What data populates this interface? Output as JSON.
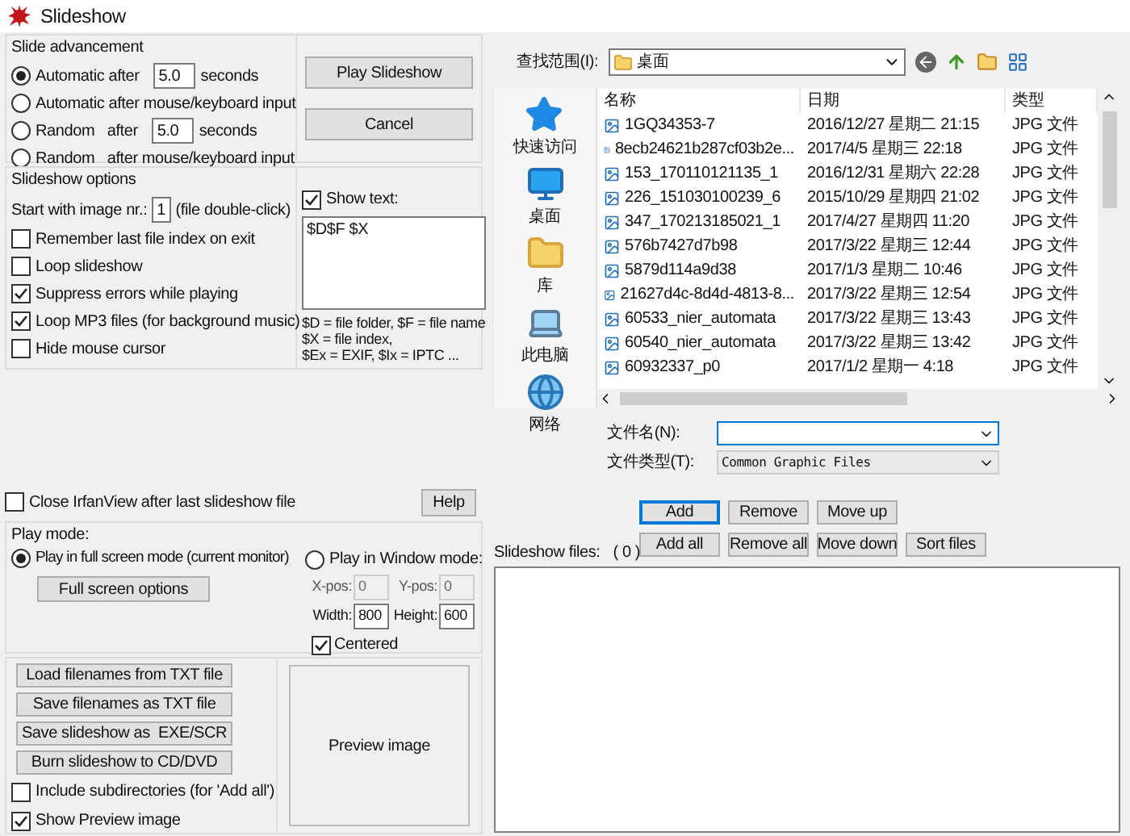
{
  "window": {
    "title": "Slideshow"
  },
  "slide_advancement": {
    "title": "Slide advancement",
    "options": [
      {
        "kind": "timed",
        "label": "Automatic after",
        "value": "5.0",
        "unit": "seconds",
        "selected": true
      },
      {
        "kind": "plain",
        "label": "Automatic after mouse/keyboard input",
        "selected": false
      },
      {
        "kind": "timed",
        "label": "Random   after",
        "value": "5.0",
        "unit": "seconds",
        "selected": false
      },
      {
        "kind": "plain",
        "label": "Random   after mouse/keyboard input",
        "selected": false
      }
    ]
  },
  "main_buttons": [
    {
      "label": "Play Slideshow"
    },
    {
      "label": "Cancel"
    }
  ],
  "slideshow_options": {
    "title": "Slideshow options",
    "start_label": "Start with image nr.:",
    "start_value": "1",
    "start_hint": "(file double-click)",
    "checkboxes": [
      {
        "label": "Remember last file index on exit",
        "checked": false
      },
      {
        "label": "Loop slideshow",
        "checked": false
      },
      {
        "label": "Suppress errors while playing",
        "checked": true
      },
      {
        "label": "Loop MP3 files (for background music)",
        "checked": true
      },
      {
        "label": "Hide mouse cursor",
        "checked": false
      }
    ],
    "show_text": {
      "label": "Show text:",
      "checked": true
    },
    "text_value": "$D$F $X",
    "legend": [
      "$D = file folder, $F = file name",
      "$X = file index,",
      "$Ex = EXIF, $Ix = IPTC ..."
    ]
  },
  "close_after": {
    "label": "Close IrfanView after last slideshow file",
    "checked": false
  },
  "help_button": "Help",
  "play_mode": {
    "title": "Play mode:",
    "full_screen": {
      "label": "Play in full screen mode (current monitor)",
      "selected": true
    },
    "full_screen_button": "Full screen options",
    "window_mode": {
      "label": "Play in Window mode:",
      "selected": false
    },
    "fields": [
      {
        "label": "X-pos:",
        "value": "0",
        "disabled": true
      },
      {
        "label": "Y-pos:",
        "value": "0",
        "disabled": true
      },
      {
        "label": "Width:",
        "value": "800",
        "disabled": false
      },
      {
        "label": "Height:",
        "value": "600",
        "disabled": false
      }
    ],
    "centered": {
      "label": "Centered",
      "checked": true
    }
  },
  "file_buttons": [
    "Load filenames from TXT file",
    "Save filenames as TXT file",
    "Save slideshow as  EXE/SCR",
    "Burn slideshow to CD/DVD"
  ],
  "bottom_checkboxes": [
    {
      "label": "Include subdirectories (for 'Add all')",
      "checked": false
    },
    {
      "label": "Show Preview image",
      "checked": true
    }
  ],
  "preview": {
    "label": "Preview image"
  },
  "file_dialog": {
    "look_in_label": "查找范围(I):",
    "look_in_value": "桌面",
    "places": [
      {
        "kind": "star",
        "label": "快速访问"
      },
      {
        "kind": "desktop",
        "label": "桌面"
      },
      {
        "kind": "library",
        "label": "库"
      },
      {
        "kind": "computer",
        "label": "此电脑"
      },
      {
        "kind": "network",
        "label": "网络"
      }
    ],
    "columns": [
      "名称",
      "日期",
      "类型"
    ],
    "rows": [
      {
        "name": "1GQ34353-7",
        "date": "2016/12/27 星期二 21:15",
        "type": "JPG 文件"
      },
      {
        "name": "8ecb24621b287cf03b2e...",
        "date": "2017/4/5 星期三 22:18",
        "type": "JPG 文件"
      },
      {
        "name": "153_170110121135_1",
        "date": "2016/12/31 星期六 22:28",
        "type": "JPG 文件"
      },
      {
        "name": "226_151030100239_6",
        "date": "2015/10/29 星期四 21:02",
        "type": "JPG 文件"
      },
      {
        "name": "347_170213185021_1",
        "date": "2017/4/27 星期四 11:20",
        "type": "JPG 文件"
      },
      {
        "name": "576b7427d7b98",
        "date": "2017/3/22 星期三 12:44",
        "type": "JPG 文件"
      },
      {
        "name": "5879d114a9d38",
        "date": "2017/1/3 星期二 10:46",
        "type": "JPG 文件"
      },
      {
        "name": "21627d4c-8d4d-4813-8...",
        "date": "2017/3/22 星期三 12:54",
        "type": "JPG 文件"
      },
      {
        "name": "60533_nier_automata",
        "date": "2017/3/22 星期三 13:43",
        "type": "JPG 文件"
      },
      {
        "name": "60540_nier_automata",
        "date": "2017/3/22 星期三 13:42",
        "type": "JPG 文件"
      },
      {
        "name": "60932337_p0",
        "date": "2017/1/2 星期一 4:18",
        "type": "JPG 文件"
      }
    ],
    "file_name_label": "文件名(N):",
    "file_type_label": "文件类型(T):",
    "file_type_value": "Common Graphic Files"
  },
  "list_buttons": [
    [
      {
        "label": "Add",
        "focused": true
      },
      {
        "label": "Remove",
        "focused": false
      },
      {
        "label": "Move up",
        "focused": false
      }
    ],
    [
      {
        "label": "Add all",
        "focused": false
      },
      {
        "label": "Remove all",
        "focused": false
      },
      {
        "label": "Move down",
        "focused": false
      },
      {
        "label": "Sort files",
        "focused": false
      }
    ]
  ],
  "slideshow_files": {
    "label": "Slideshow files:",
    "count": "( 0 )"
  }
}
